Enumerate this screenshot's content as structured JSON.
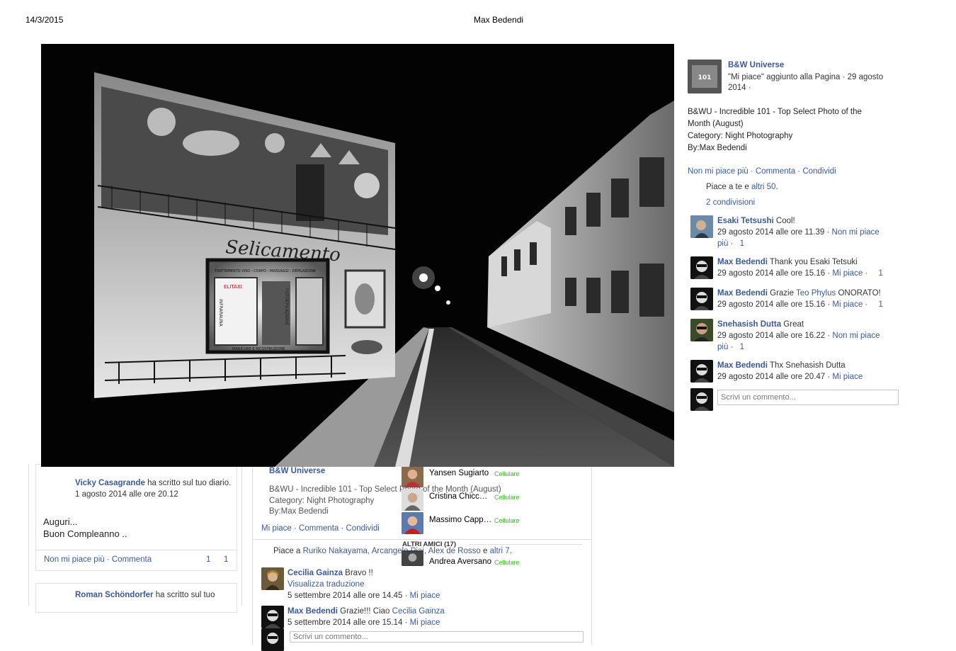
{
  "header": {
    "date": "14/3/2015",
    "title": "Max Bedendi"
  },
  "photo": {
    "sign_text": "Selicamento",
    "window_text_1": "TRATTAMENTO VISO - CORPO - MASSAGGI - DEPILAZIONE",
    "window_text_2": "MANICURE E RICOSTRUZIONE",
    "window_vertical_1": "INFRARAUNA",
    "window_vertical_2": "FOTOEPILAZIONE",
    "window_small": "ELITAXI"
  },
  "right_panel": {
    "page_name": "B&W Universe",
    "page_thumb_text": "101",
    "subtitle": "\"Mi piace\" aggiunto alla Pagina · 29 agosto 2014 ·",
    "desc_lines": [
      "B&WU - Incredible 101 - Top Select Photo of the",
      "Month (August)",
      "Category: Night Photography",
      "By:Max Bedendi"
    ],
    "actions": "Non mi piace più · Commenta · Condividi",
    "likes_prefix": "Piace a te e ",
    "likes_link": "altri 50",
    "likes_suffix": ".",
    "shares": "2 condivisioni",
    "comments": [
      {
        "who": "Esaki Tetsushi",
        "text": " Cool!",
        "time": "29 agosto 2014 alle ore 11.39 · ",
        "action": "Non mi piace",
        "extra": "più · ",
        "count": "1"
      },
      {
        "who": "Max Bedendi",
        "text": " Thank you Esaki Tetsuki",
        "time": "29 agosto 2014 alle ore 15.16 · ",
        "action": "Mi piace · ",
        "extra": "",
        "count": "1"
      },
      {
        "who": "Max Bedendi",
        "text_pre": " Grazie ",
        "text_link": "Teo Phylus",
        "text_post": " ONORATO!",
        "time": "29 agosto 2014 alle ore 15.16 · ",
        "action": "Mi piace · ",
        "count": "1"
      },
      {
        "who": "Snehasish Dutta",
        "text": " Great",
        "time": "29 agosto 2014 alle ore 16.22 · ",
        "action": "Non mi piace",
        "extra": "più · ",
        "count": "1"
      },
      {
        "who": "Max Bedendi",
        "text": " Thx Snehasish Dutta",
        "time": "29 agosto 2014 alle ore 20.47 · ",
        "action": "Mi piace"
      }
    ],
    "comment_placeholder": "Scrivi un commento..."
  },
  "left_col": {
    "post1_who": "Vicky Casagrande",
    "post1_what": " ha scritto sul tuo diario.",
    "post1_time": "1 agosto 2014 alle ore 20.12",
    "post1_msg_1": "Auguri...",
    "post1_msg_2": "Buon Compleanno ..",
    "post1_actions": "Non mi piace più · Commenta",
    "post1_count_1": "1",
    "post1_count_2": "1",
    "post2_who": "Roman Schöndorfer",
    "post2_what": " ha scritto sul tuo"
  },
  "middle": {
    "page_name": "B&W Universe",
    "desc_lines": [
      "B&WU - Incredible 101 - Top Select Photo of the Month (August)",
      "Category: Night Photography",
      "By:Max Bedendi"
    ],
    "actions": "Mi piace · Commenta · Condividi",
    "likes_prefix": "Piace a ",
    "likes_names": "Ruriko Nakayama, Arcangelo Piai, Alex de Rosso",
    "likes_mid": " e ",
    "likes_more": "altri 7",
    "likes_suffix": ".",
    "c1_who": "Cecilia Gainza",
    "c1_text": " Bravo !!",
    "c1_translate": "Visualizza traduzione",
    "c1_time": "5 settembre 2014 alle ore 14.45 · ",
    "c1_action": "Mi piace",
    "c2_who": "Max Bedendi",
    "c2_text": " Grazie!!! Ciao ",
    "c2_link": "Cecilia Gainza",
    "c2_time": "5 settembre 2014 alle ore 15.14 · ",
    "c2_action": "Mi piace",
    "write_placeholder": "Scrivi un commento..."
  },
  "chat": {
    "rows": [
      {
        "name": "Yansen Sugiarto",
        "status": "Cellulare"
      },
      {
        "name": "Cristina Chicc…",
        "status": "Cellulare"
      },
      {
        "name": "Massimo Capp…",
        "status": "Cellulare"
      }
    ],
    "section": "ALTRI AMICI (17)",
    "last": {
      "name": "Andrea Aversano",
      "status": "Cellulare"
    }
  },
  "colors": {
    "link": "#3b5998",
    "online": "#42b72a"
  }
}
